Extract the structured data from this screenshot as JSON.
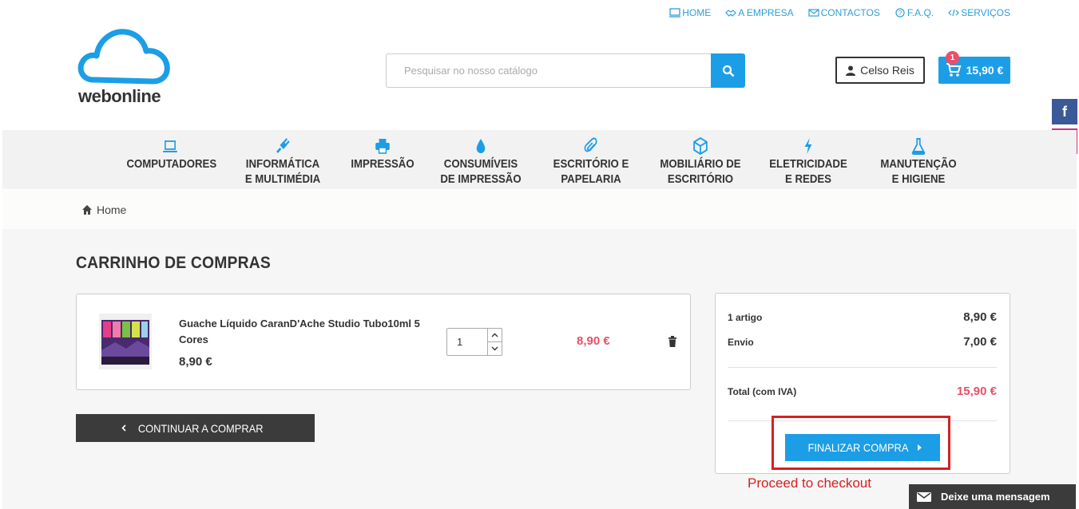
{
  "top_links": [
    {
      "label": "HOME",
      "icon": "monitor-icon"
    },
    {
      "label": "A EMPRESA",
      "icon": "handshake-icon"
    },
    {
      "label": "CONTACTOS",
      "icon": "envelope-icon"
    },
    {
      "label": "F.A.Q.",
      "icon": "question-icon"
    },
    {
      "label": "SERVIÇOS",
      "icon": "code-icon"
    }
  ],
  "logo": {
    "text": "webonline"
  },
  "search": {
    "placeholder": "Pesquisar no nosso catálogo"
  },
  "user": {
    "name": "Celso Reis"
  },
  "cart": {
    "total": "15,90 €",
    "count": "1"
  },
  "social": {
    "facebook": "f"
  },
  "nav": [
    {
      "line1": "COMPUTADORES",
      "line2": "",
      "icon": "laptop-icon"
    },
    {
      "line1": "INFORMÁTICA",
      "line2": "E MULTIMÉDIA",
      "icon": "plug-icon"
    },
    {
      "line1": "IMPRESSÃO",
      "line2": "",
      "icon": "printer-icon"
    },
    {
      "line1": "CONSUMÍVEIS",
      "line2": "DE IMPRESSÃO",
      "icon": "droplet-icon"
    },
    {
      "line1": "ESCRITÓRIO E",
      "line2": "PAPELARIA",
      "icon": "paperclip-icon"
    },
    {
      "line1": "MOBILIÁRIO DE",
      "line2": "ESCRITÓRIO",
      "icon": "cube-icon"
    },
    {
      "line1": "ELETRICIDADE",
      "line2": "E REDES",
      "icon": "bolt-icon"
    },
    {
      "line1": "MANUTENÇÃO",
      "line2": "E HIGIENE",
      "icon": "flask-icon"
    }
  ],
  "breadcrumb": {
    "home": "Home"
  },
  "page_title": "CARRINHO DE COMPRAS",
  "cart_item": {
    "name": "Guache Líquido CaranD'Ache Studio Tubo10ml 5 Cores",
    "unit_price": "8,90 €",
    "quantity": "1",
    "line_total": "8,90 €"
  },
  "continue_label": "CONTINUAR A COMPRAR",
  "summary": {
    "items_label": "1 artigo",
    "items_value": "8,90 €",
    "shipping_label": "Envio",
    "shipping_value": "7,00 €",
    "total_label": "Total (com IVA)",
    "total_value": "15,90 €",
    "checkout_label": "FINALIZAR COMPRA"
  },
  "annotation": "Proceed to checkout",
  "chat": {
    "label": "Deixe uma mensagem"
  },
  "colors": {
    "accent": "#1c9ee6",
    "price": "#e94f6b",
    "dark": "#3b3b3b",
    "highlight": "#d62020"
  }
}
